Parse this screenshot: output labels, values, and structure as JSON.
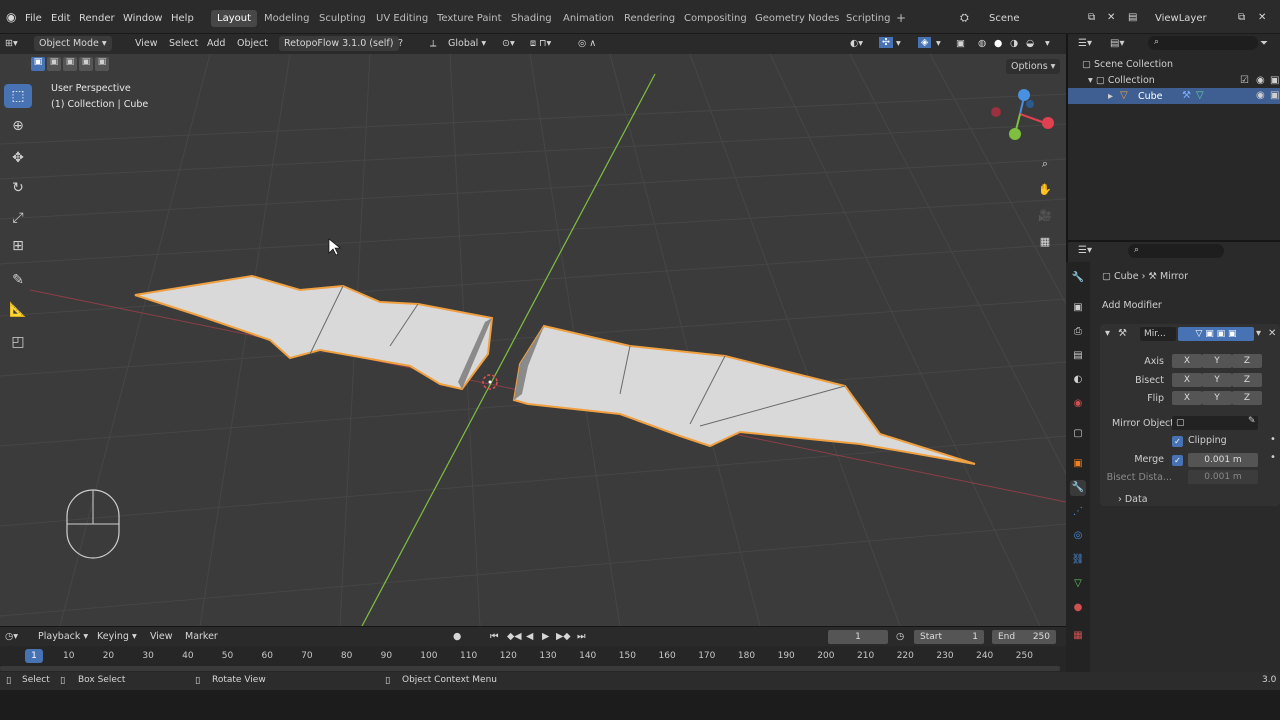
{
  "menu": [
    "File",
    "Edit",
    "Render",
    "Window",
    "Help"
  ],
  "workspaces": [
    "Layout",
    "Modeling",
    "Sculpting",
    "UV Editing",
    "Texture Paint",
    "Shading",
    "Animation",
    "Rendering",
    "Compositing",
    "Geometry Nodes",
    "Scripting"
  ],
  "active_workspace": "Layout",
  "scene_name": "Scene",
  "view_layer": "ViewLayer",
  "viewport_header": {
    "mode": "Object Mode",
    "items": [
      "View",
      "Select",
      "Add",
      "Object"
    ],
    "addon": "RetopoFlow 3.1.0 (self)",
    "orientation": "Global"
  },
  "viewport": {
    "options_label": "Options",
    "perspective_text": "User Perspective",
    "collection_text": "(1) Collection | Cube"
  },
  "outliner": {
    "scene_collection": "Scene Collection",
    "collection": "Collection",
    "object": "Cube"
  },
  "properties": {
    "breadcrumb_object": "Cube",
    "breadcrumb_modifier": "Mirror",
    "add_modifier": "Add Modifier",
    "modifier_name": "Mir...",
    "axis_label": "Axis",
    "bisect_label": "Bisect",
    "flip_label": "Flip",
    "axes": [
      "X",
      "Y",
      "Z"
    ],
    "mirror_object_label": "Mirror Object",
    "clipping_label": "Clipping",
    "merge_label": "Merge",
    "merge_value": "0.001 m",
    "bisect_distance_label": "Bisect Dista...",
    "bisect_distance_value": "0.001 m",
    "data_label": "Data"
  },
  "timeline": {
    "items": [
      "Playback",
      "Keying",
      "View",
      "Marker"
    ],
    "current_frame": "1",
    "start_label": "Start",
    "start_value": "1",
    "end_label": "End",
    "end_value": "250",
    "ruler": [
      "10",
      "20",
      "30",
      "40",
      "50",
      "60",
      "70",
      "80",
      "90",
      "100",
      "110",
      "120",
      "130",
      "140",
      "150",
      "160",
      "170",
      "180",
      "190",
      "200",
      "210",
      "220",
      "230",
      "240",
      "250"
    ],
    "ruler_current": "1"
  },
  "statusbar": {
    "select": "Select",
    "box_select": "Box Select",
    "rotate_view": "Rotate View",
    "context_menu": "Object Context Menu",
    "version": "3.0"
  },
  "colors": {
    "accent": "#4772b3",
    "selection_outline": "#f0a040",
    "grid_bg": "#3b3b3b",
    "y_axis": "#7fbf3f",
    "x_axis": "#c04050"
  }
}
